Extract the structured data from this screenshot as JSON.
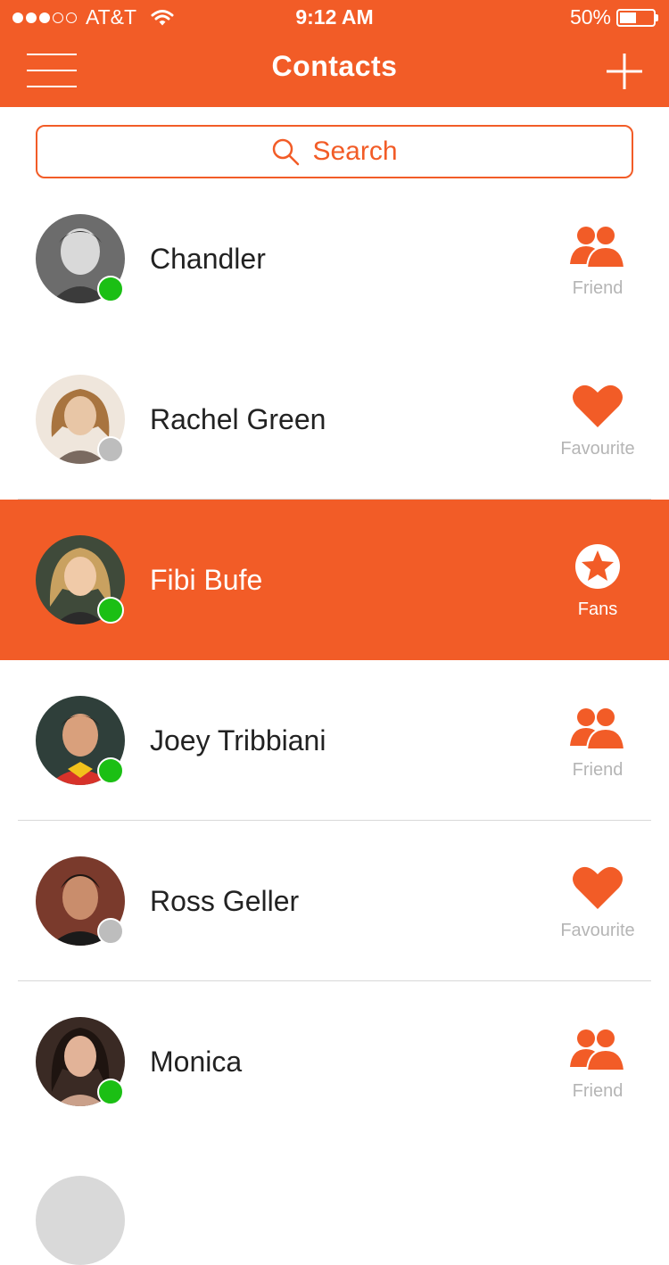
{
  "status_bar": {
    "signal_filled": 3,
    "signal_total": 5,
    "carrier": "AT&T",
    "time": "9:12 AM",
    "battery": "50%",
    "battery_level": 0.5
  },
  "header": {
    "title": "Contacts",
    "menu_icon": "hamburger-menu-icon",
    "add_icon": "plus-icon"
  },
  "search": {
    "placeholder": "Search",
    "icon": "search-icon"
  },
  "colors": {
    "accent": "#f25c27",
    "online": "#1bbf14",
    "offline": "#bdbdbd"
  },
  "contacts": [
    {
      "name": "Chandler",
      "status": "online",
      "badge": "friend",
      "badge_label": "Friend"
    },
    {
      "name": "Rachel Green",
      "status": "offline",
      "badge": "favourite",
      "badge_label": "Favourite"
    },
    {
      "name": "Fibi Bufe",
      "status": "online",
      "badge": "fans",
      "badge_label": "Fans",
      "selected": true
    },
    {
      "name": "Joey Tribbiani",
      "status": "online",
      "badge": "friend",
      "badge_label": "Friend"
    },
    {
      "name": "Ross Geller",
      "status": "offline",
      "badge": "favourite",
      "badge_label": "Favourite"
    },
    {
      "name": "Monica",
      "status": "online",
      "badge": "friend",
      "badge_label": "Friend"
    }
  ]
}
